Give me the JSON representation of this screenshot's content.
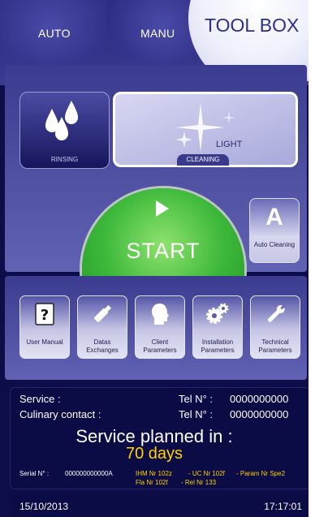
{
  "tabs": {
    "auto": "AUTO",
    "manu": "MANU",
    "toolbox": "TOOL BOX"
  },
  "modes": {
    "rinsing": "RINSING",
    "cleaning": "CLEANING",
    "cleaning_level": "LIGHT",
    "start": "START",
    "auto_cleaning_symbol": "A",
    "auto_cleaning": "Auto Cleaning"
  },
  "tools": [
    {
      "label": "User Manual",
      "icon": "question-book-icon"
    },
    {
      "label": "Datas Exchanges",
      "icon": "usb-key-icon"
    },
    {
      "label": "Client Parameters",
      "icon": "head-silhouette-icon"
    },
    {
      "label": "Installation Parameters",
      "icon": "gears-icon"
    },
    {
      "label": "Technical Parameters",
      "icon": "wrench-icon"
    }
  ],
  "info": {
    "service_label": "Service :",
    "culinary_label": "Culinary contact :",
    "tel_label": "Tel N° :",
    "service_tel": "0000000000",
    "culinary_tel": "0000000000",
    "planned_label": "Service planned in :",
    "planned_days": "70 days",
    "serial_label": "Serial N° :",
    "serial_value": "000000000000A",
    "ihm": "IHM Nr  102z",
    "uc": "- UC Nr  102f",
    "param": "- Param Nr  Spe2",
    "fla": "Fla Nr  102f",
    "rel": "- Rel Nr  133"
  },
  "footer": {
    "date": "15/10/2013",
    "time": "17:17:01"
  }
}
